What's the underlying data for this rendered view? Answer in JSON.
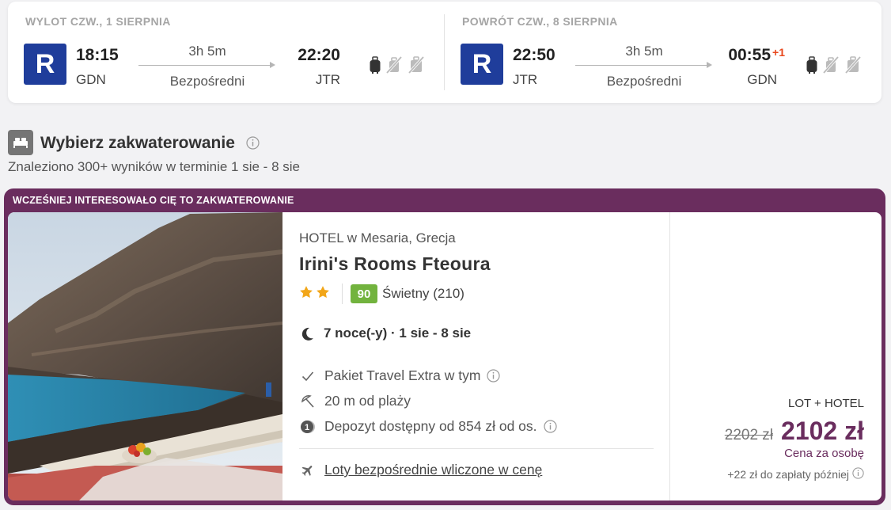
{
  "flights": {
    "outbound": {
      "title": "WYLOT CZW., 1 SIERPNIA",
      "airline_logo": "R",
      "departure_time": "18:15",
      "departure_airport": "GDN",
      "duration": "3h 5m",
      "route_type": "Bezpośredni",
      "arrival_time": "22:20",
      "arrival_airport": "JTR",
      "icons": [
        "cabin-bag-icon",
        "no-hand-luggage-icon",
        "no-checked-bag-icon"
      ]
    },
    "return": {
      "title": "POWRÓT CZW., 8 SIERPNIA",
      "airline_logo": "R",
      "departure_time": "22:50",
      "departure_airport": "JTR",
      "duration": "3h 5m",
      "route_type": "Bezpośredni",
      "arrival_time": "00:55",
      "arrival_day_offset": "+1",
      "arrival_airport": "GDN",
      "icons": [
        "cabin-bag-icon",
        "no-hand-luggage-icon",
        "no-checked-bag-icon"
      ]
    },
    "airline_color": "#1f3d9b"
  },
  "accommodation": {
    "section_title": "Wybierz zakwaterowanie",
    "results": "Znaleziono 300+ wyników w terminie 1 sie - 8 sie"
  },
  "hotel": {
    "banner": "WCZEŚNIEJ INTERESOWAŁO CIĘ TO ZAKWATEROWANIE",
    "type_location": "HOTEL w Mesaria, Grecja",
    "name": "Irini's Rooms Fteoura",
    "stars": 2,
    "rating_score": "90",
    "rating_text": "Świetny (210)",
    "nights": "7 noce(-y) · 1 sie - 8 sie",
    "features": [
      {
        "icon": "check-icon",
        "text": "Pakiet Travel Extra w tym"
      },
      {
        "icon": "beach-umbrella-icon",
        "text": "20 m od plaży"
      },
      {
        "icon": "deposit-icon",
        "text": "Depozyt dostępny od 854 zł od os."
      }
    ],
    "flights_included": "Loty bezpośrednie wliczone w cenę",
    "price": {
      "package_label": "LOT + HOTEL",
      "old_price": "2202 zł",
      "new_price": "2102 zł",
      "per_person": "Cena za osobę",
      "pay_later": "+22 zł do zapłaty później"
    },
    "accent_color": "#6a2d5e",
    "rating_color": "#72b33e"
  }
}
